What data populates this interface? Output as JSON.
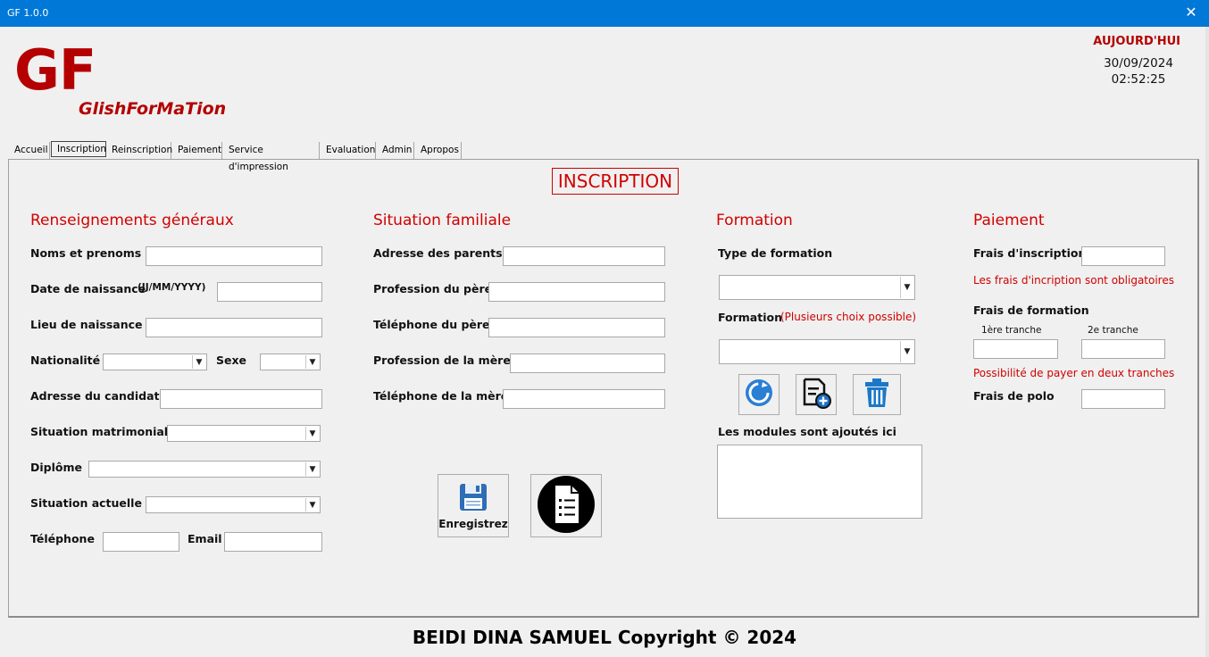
{
  "window": {
    "title": "GF 1.0.0",
    "close_glyph": "✕"
  },
  "brand": {
    "logo": "GF",
    "name": "GlishForMaTion"
  },
  "clock": {
    "label": "AUJOURD'HUI",
    "date": "30/09/2024",
    "time": "02:52:25"
  },
  "tabs": [
    {
      "label": "Accueil"
    },
    {
      "label": "Inscription",
      "active": true
    },
    {
      "label": "Reinscription"
    },
    {
      "label": "Paiement"
    },
    {
      "label": "Service d'impression"
    },
    {
      "label": "Evaluation"
    },
    {
      "label": "Admin"
    },
    {
      "label": "Apropos"
    }
  ],
  "page_title": "INSCRIPTION",
  "general": {
    "title": "Renseignements généraux",
    "noms": "Noms et prenoms",
    "naissance": "Date de naissance",
    "naissance_fmt": "(JJ/MM/YYYY)",
    "lieu": "Lieu de naissance",
    "nationalite": "Nationalité",
    "sexe": "Sexe",
    "adresse": "Adresse du candidat",
    "matrimoniale": "Situation matrimoniale",
    "diplome": "Diplôme",
    "actuelle": "Situation actuelle",
    "telephone": "Téléphone",
    "email": "Email"
  },
  "family": {
    "title": "Situation familiale",
    "adresse_parents": "Adresse des parents",
    "profession_pere": "Profession du père",
    "tel_pere": "Téléphone du père",
    "profession_mere": "Profession de la mère",
    "tel_mere": "Téléphone de la mère"
  },
  "training": {
    "title": "Formation",
    "type": "Type de formation",
    "formation": "Formation",
    "formation_note": "(Plusieurs choix possible)",
    "modules_label": "Les modules sont ajoutés ici",
    "icons": [
      "refresh-icon",
      "add-list-icon",
      "trash-icon"
    ]
  },
  "payment": {
    "title": "Paiement",
    "inscription": "Frais d'inscription",
    "inscription_note": "Les frais d'incription sont obligatoires",
    "formation": "Frais de formation",
    "tranche1": "1ère tranche",
    "tranche2": "2e tranche",
    "tranche_note": "Possibilité de payer en deux tranches",
    "polo": "Frais de polo"
  },
  "actions": {
    "save_label": "Enregistrez"
  },
  "footer": "BEIDI DINA SAMUEL Copyright © 2024",
  "colors": {
    "accent": "#d10000",
    "logo": "#b40000",
    "titlebar": "#0078d7"
  }
}
